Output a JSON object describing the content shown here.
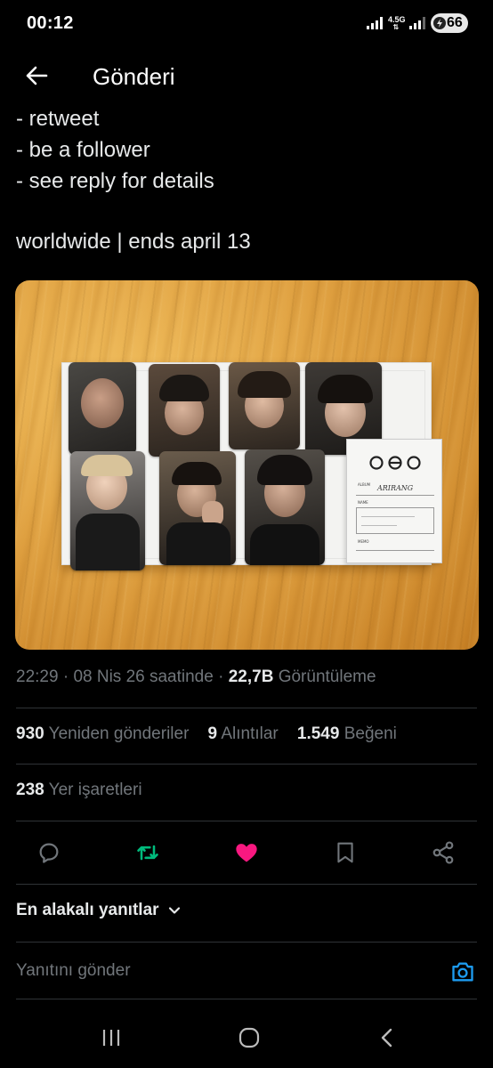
{
  "status_bar": {
    "time": "00:12",
    "network_label": "4.5G",
    "battery_level": "66",
    "icons": [
      "signal-icon",
      "signal-icon",
      "battery-charging-icon"
    ]
  },
  "header": {
    "back_icon": "arrow-left-icon",
    "title": "Gönderi"
  },
  "tweet": {
    "lines": [
      "- retweet",
      "- be a follower",
      "- see reply for details"
    ],
    "footer_line": "worldwide | ends april 13",
    "media": {
      "type": "photo",
      "album_card": {
        "album_label": "ALBUM",
        "album_handwriting": "ARIRANG",
        "name_label": "NAME",
        "memo_label": "MEMO"
      }
    }
  },
  "meta": {
    "time": "22:29",
    "separator": "·",
    "date_text": "08 Nis 26 saatinde",
    "separator2": "·",
    "views_count": "22,7B",
    "views_label": "Görüntüleme"
  },
  "stats": {
    "reposts_count": "930",
    "reposts_label": "Yeniden gönderiler",
    "quotes_count": "9",
    "quotes_label": "Alıntılar",
    "likes_count": "1.549",
    "likes_label": "Beğeni",
    "bookmarks_count": "238",
    "bookmarks_label": "Yer işaretleri"
  },
  "actions": {
    "icons": [
      "reply-icon",
      "retweet-icon",
      "like-icon",
      "bookmark-icon",
      "share-icon"
    ],
    "retweet_active_color": "#00ba7c",
    "like_active_color": "#f91880"
  },
  "replies": {
    "sort_label": "En alakalı yanıtlar",
    "reply_placeholder": "Yanıtını gönder",
    "accent_color": "#1d9bf0"
  },
  "nav": {
    "icons": [
      "recent-apps-icon",
      "home-icon",
      "back-icon"
    ]
  }
}
